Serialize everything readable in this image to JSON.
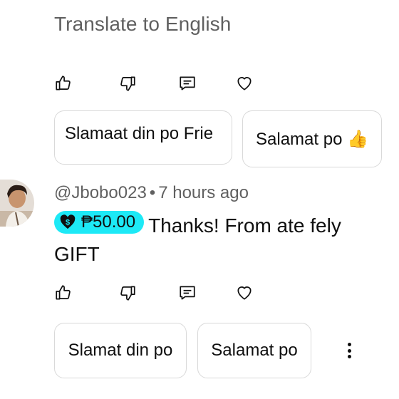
{
  "top": {
    "translate_label": "Translate to English"
  },
  "first_actions": {
    "icons": [
      "thumbs-up-icon",
      "thumbs-down-icon",
      "reply-icon",
      "heart-icon"
    ]
  },
  "first_replies": [
    {
      "text": "Slamaat din po Frie"
    },
    {
      "text": "Salamat po 👍"
    }
  ],
  "comment": {
    "author": "@Jbobo023",
    "separator": "•",
    "time": "7 hours ago",
    "superchat_amount": "₱50.00",
    "superchat_color": "#1de9f6",
    "text_line1": "Thanks! From ate fely",
    "text_line2": "GIFT"
  },
  "second_replies": [
    {
      "text": "Slamat din po"
    },
    {
      "text": "Salamat po"
    }
  ]
}
